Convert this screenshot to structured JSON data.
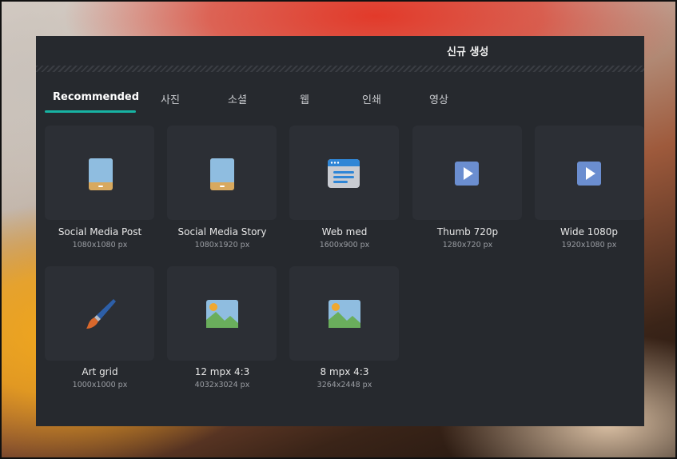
{
  "window": {
    "title": "신규 생성"
  },
  "tabs": [
    {
      "label": "Recommended",
      "active": true
    },
    {
      "label": "사진"
    },
    {
      "label": "소셜"
    },
    {
      "label": "웹"
    },
    {
      "label": "인쇄"
    },
    {
      "label": "영상"
    }
  ],
  "templates": [
    {
      "name": "Social Media Post",
      "size": "1080x1080 px",
      "icon": "tablet-icon"
    },
    {
      "name": "Social Media Story",
      "size": "1080x1920 px",
      "icon": "tablet-icon"
    },
    {
      "name": "Web med",
      "size": "1600x900 px",
      "icon": "browser-window-icon"
    },
    {
      "name": "Thumb 720p",
      "size": "1280x720 px",
      "icon": "play-icon"
    },
    {
      "name": "Wide 1080p",
      "size": "1920x1080 px",
      "icon": "play-icon"
    },
    {
      "name": "Art grid",
      "size": "1000x1000 px",
      "icon": "paintbrush-icon"
    },
    {
      "name": "12 mpx 4:3",
      "size": "4032x3024 px",
      "icon": "landscape-image-icon"
    },
    {
      "name": "8 mpx 4:3",
      "size": "3264x2448 px",
      "icon": "landscape-image-icon"
    }
  ],
  "colors": {
    "accent": "#17b3a3",
    "panel": "#26292e",
    "card": "#2c2f35"
  }
}
